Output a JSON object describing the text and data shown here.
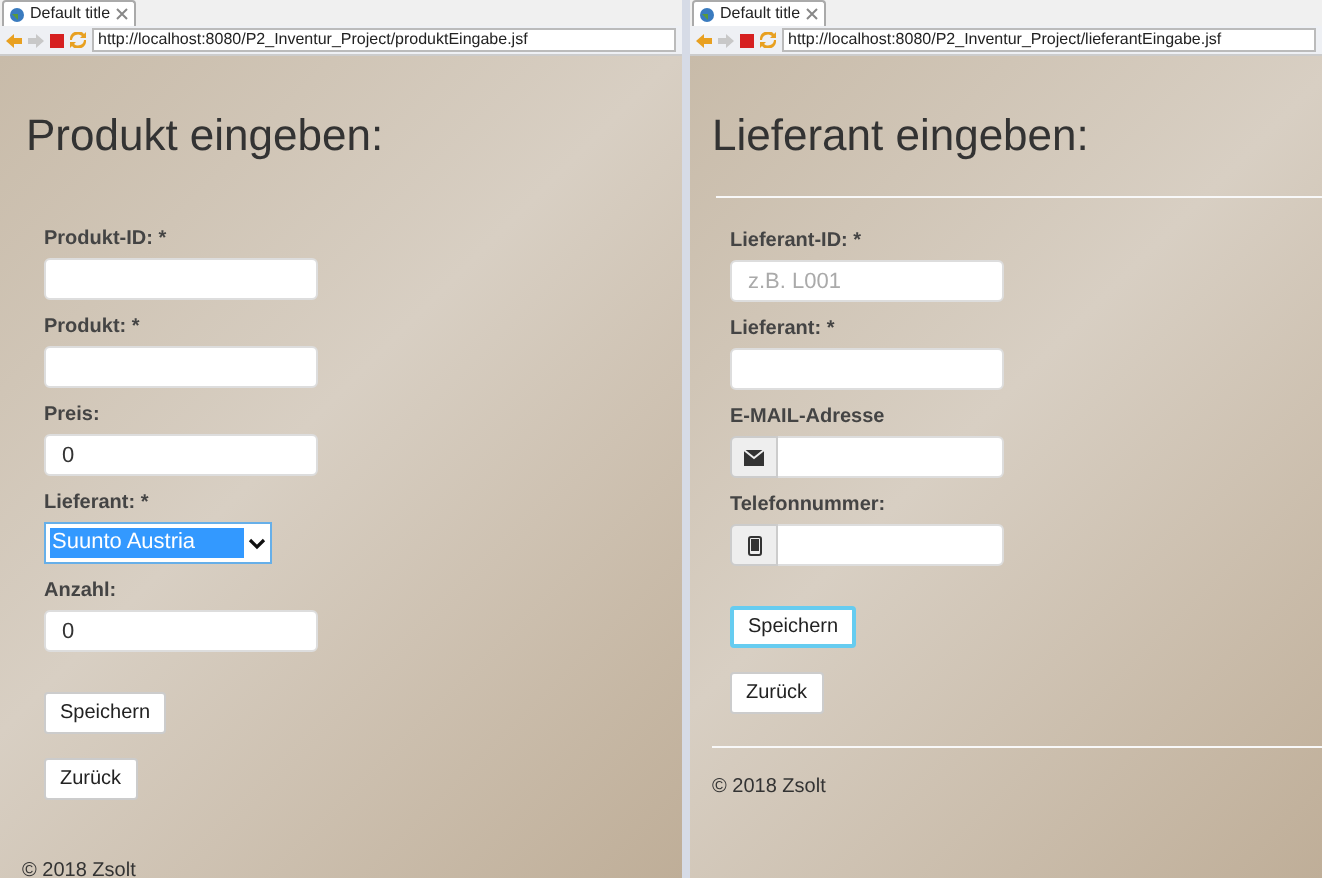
{
  "panes": [
    {
      "tab": {
        "title": "Default title"
      },
      "url": "http://localhost:8080/P2_Inventur_Project/produktEingabe.jsf",
      "heading": "Produkt eingeben:",
      "fields": [
        {
          "kind": "text",
          "label": "Produkt-ID: *"
        },
        {
          "kind": "text",
          "label": "Produkt: *"
        },
        {
          "kind": "text",
          "label": "Preis:",
          "value": "0"
        },
        {
          "kind": "select",
          "label": "Lieferant: *",
          "value": "Suunto Austria",
          "highlighted": true
        },
        {
          "kind": "text",
          "label": "Anzahl:",
          "value": "0"
        }
      ],
      "buttons": [
        {
          "label": "Speichern",
          "focused": false
        },
        {
          "label": "Zurück",
          "focused": false
        }
      ],
      "footer": "© 2018 Zsolt"
    },
    {
      "tab": {
        "title": "Default title"
      },
      "url": "http://localhost:8080/P2_Inventur_Project/lieferantEingabe.jsf",
      "heading": "Lieferant eingeben:",
      "fields": [
        {
          "kind": "text",
          "label": "Lieferant-ID: *",
          "placeholder": "z.B. L001"
        },
        {
          "kind": "text",
          "label": "Lieferant: *"
        },
        {
          "kind": "email",
          "label": "E-MAIL-Adresse"
        },
        {
          "kind": "phone",
          "label": "Telefonnummer:"
        }
      ],
      "buttons": [
        {
          "label": "Speichern",
          "focused": true
        },
        {
          "label": "Zurück",
          "focused": false
        }
      ],
      "footer": "© 2018 Zsolt"
    }
  ]
}
